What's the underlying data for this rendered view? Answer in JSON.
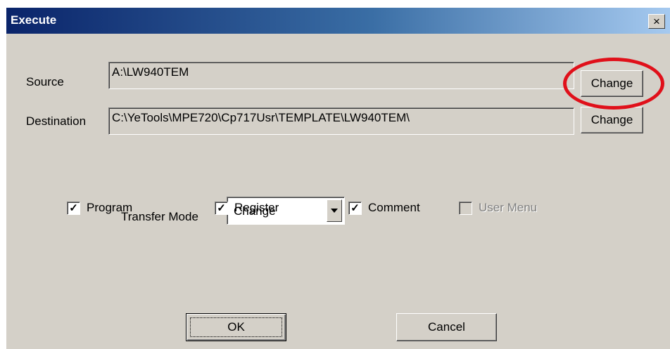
{
  "window": {
    "title": "Execute",
    "close_glyph": "×"
  },
  "source": {
    "label": "Source",
    "value": "A:\\LW940TEM",
    "change_label": "Change"
  },
  "destination": {
    "label": "Destination",
    "value": "C:\\YeTools\\MPE720\\Cp717Usr\\TEMPLATE\\LW940TEM\\",
    "change_label": "Change"
  },
  "transfer_mode": {
    "label": "Transfer Mode",
    "selected": "Change"
  },
  "checkboxes": [
    {
      "label": "Program",
      "checked": true,
      "enabled": true
    },
    {
      "label": "Register",
      "checked": true,
      "enabled": true
    },
    {
      "label": "Comment",
      "checked": true,
      "enabled": true
    },
    {
      "label": "User Menu",
      "checked": false,
      "enabled": false
    }
  ],
  "buttons": {
    "ok_label": "OK",
    "cancel_label": "Cancel"
  },
  "colors": {
    "annotation": "#e0101a",
    "titlebar_start": "#0a246a",
    "titlebar_end": "#a6caf0",
    "dialog_bg": "#d4d0c8"
  }
}
